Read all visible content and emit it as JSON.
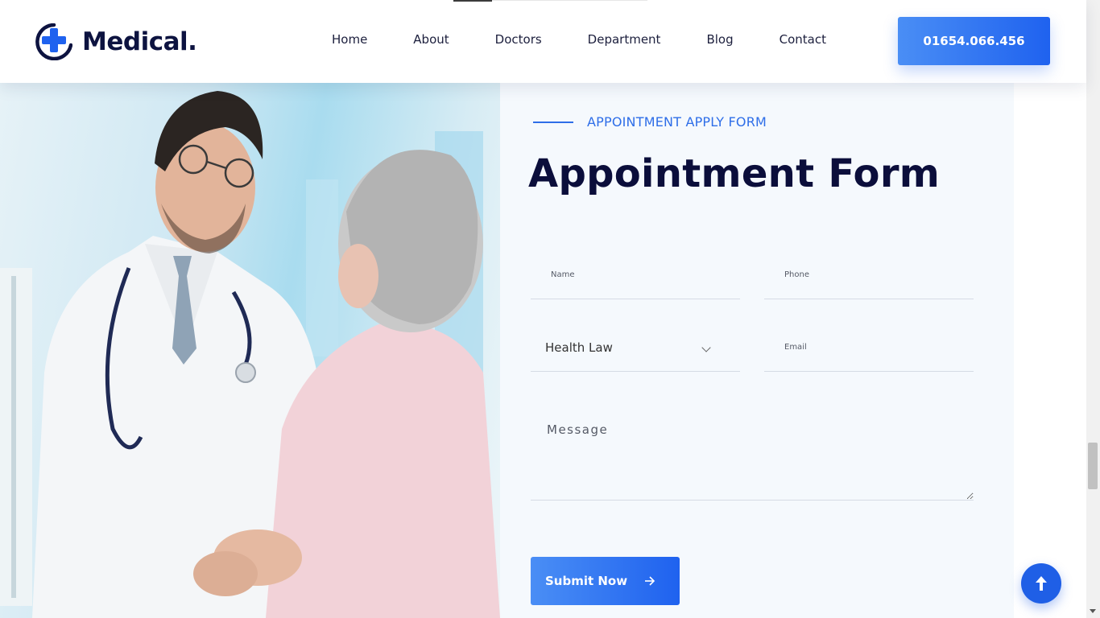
{
  "header": {
    "logo_text": "Medical.",
    "nav": [
      "Home",
      "About",
      "Doctors",
      "Department",
      "Blog",
      "Contact"
    ],
    "phone": "01654.066.456"
  },
  "hero": {
    "image": "doctor-greeting-patient-photo"
  },
  "form": {
    "eyebrow": "APPOINTMENT APPLY FORM",
    "title": "Appointment Form",
    "name_placeholder": "Name",
    "phone_placeholder": "Phone",
    "department_selected": "Health Law",
    "email_placeholder": "Email",
    "message_placeholder": "Message",
    "submit_label": "Submit Now"
  },
  "colors": {
    "accent": "#1f62ef",
    "heading": "#0b0e3b",
    "panel_bg": "#f5f9fd"
  }
}
